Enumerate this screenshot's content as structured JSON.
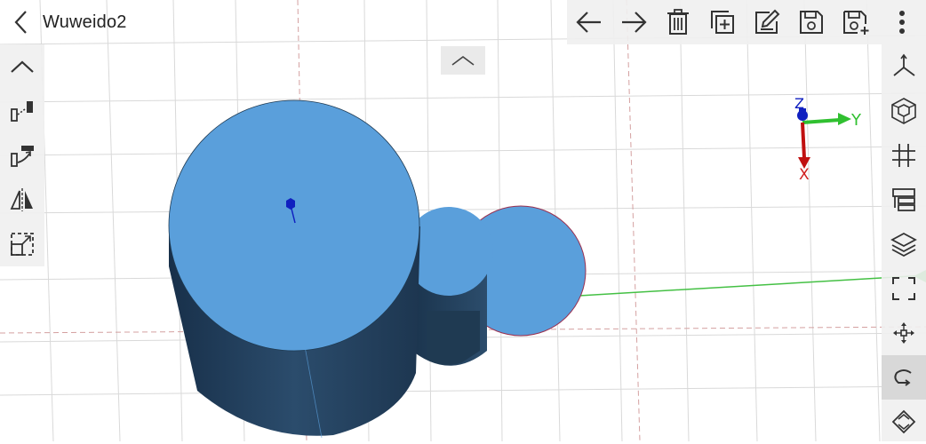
{
  "header": {
    "title": "Wuweido2"
  },
  "top_toolbar": {
    "items": [
      {
        "name": "undo",
        "icon": "arrow-left-icon"
      },
      {
        "name": "redo",
        "icon": "arrow-right-icon"
      },
      {
        "name": "delete",
        "icon": "trash-icon"
      },
      {
        "name": "duplicate",
        "icon": "copy-add-icon"
      },
      {
        "name": "edit",
        "icon": "edit-icon"
      },
      {
        "name": "save",
        "icon": "save-icon"
      },
      {
        "name": "save-as",
        "icon": "save-as-icon"
      },
      {
        "name": "more",
        "icon": "more-vertical-icon"
      }
    ]
  },
  "left_toolbar": {
    "items": [
      {
        "name": "collapse",
        "icon": "chevron-up-icon"
      },
      {
        "name": "extrude",
        "icon": "extrude-icon"
      },
      {
        "name": "sweep",
        "icon": "sweep-icon"
      },
      {
        "name": "mirror",
        "icon": "mirror-icon"
      },
      {
        "name": "scale",
        "icon": "scale-icon"
      }
    ]
  },
  "right_toolbar": {
    "items": [
      {
        "name": "axes",
        "icon": "axes-icon"
      },
      {
        "name": "view-cube",
        "icon": "view-cube-icon"
      },
      {
        "name": "grid",
        "icon": "grid-icon"
      },
      {
        "name": "layers-panel",
        "icon": "panel-icon"
      },
      {
        "name": "layers",
        "icon": "layers-icon"
      },
      {
        "name": "fit-view",
        "icon": "fullscreen-icon"
      },
      {
        "name": "pan",
        "icon": "move-icon"
      },
      {
        "name": "rotate",
        "icon": "rotate-icon",
        "active": true
      },
      {
        "name": "zoom",
        "icon": "zoom-icon"
      }
    ]
  },
  "gizmo": {
    "x_label": "X",
    "y_label": "Y",
    "z_label": "Z"
  },
  "colors": {
    "shape_top": "#5a9fdb",
    "shape_side_dark": "#1f3a52",
    "shape_side_mid": "#2c4f6e",
    "grid_line": "#d6d6d6",
    "grid_red": "#d9a0a0",
    "axis_x": "#e02020",
    "axis_y": "#30c030",
    "axis_z": "#1020c0",
    "toolbar_bg": "#f0f0f0"
  }
}
